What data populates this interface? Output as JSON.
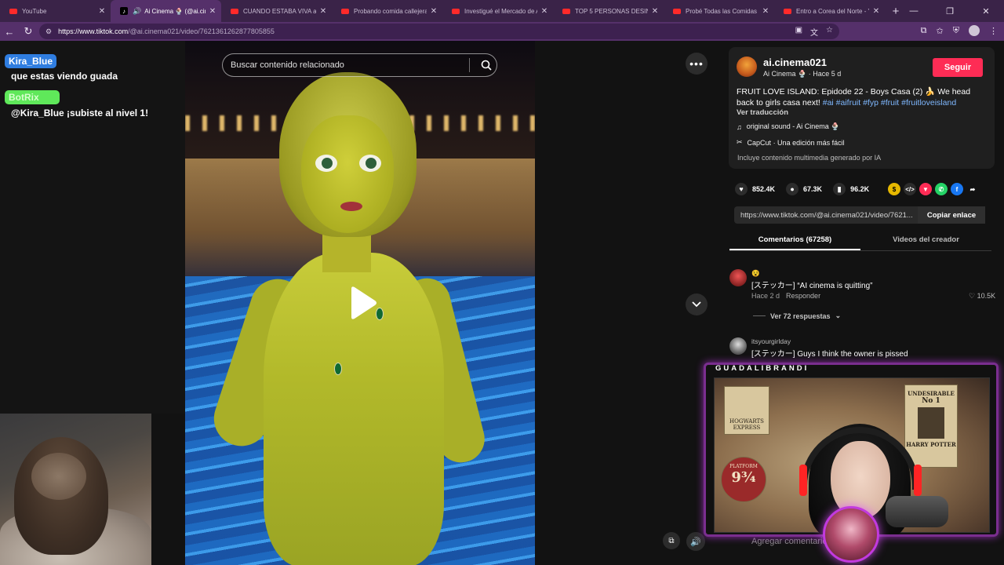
{
  "browser": {
    "tabs": [
      {
        "title": "YouTube",
        "type": "yt",
        "active": false
      },
      {
        "title": "Ai Cinema 🍨 (@ai.cinema",
        "type": "tt",
        "active": true
      },
      {
        "title": "CUANDO ESTABA VIVA a NA",
        "type": "yt",
        "active": false
      },
      {
        "title": "Probando comida callejera e",
        "type": "yt",
        "active": false
      },
      {
        "title": "Investigué el Mercado de An",
        "type": "yt",
        "active": false
      },
      {
        "title": "TOP 5 PERSONAS DESINFOR",
        "type": "yt",
        "active": false
      },
      {
        "title": "Probé Todas las Comidas XX",
        "type": "yt",
        "active": false
      },
      {
        "title": "Entro a Corea del Norte - Yo",
        "type": "yt",
        "active": false
      }
    ],
    "url_host": "https://www.tiktok.com",
    "url_path": "/@ai.cinema021/video/7621361262877805855"
  },
  "chat": {
    "user1": "Kira_Blue",
    "msg1": "que estas viendo guada",
    "user2": "BotRix",
    "msg2": "@Kira_Blue ¡subiste al nivel 1!"
  },
  "search": {
    "placeholder": "Buscar contenido relacionado"
  },
  "creator": {
    "handle": "ai.cinema021",
    "name": "Ai Cinema 🍨",
    "age": "Hace 5 d",
    "follow_label": "Seguir"
  },
  "caption": {
    "text": "FRUIT LOVE ISLAND: Epidode 22 - Boys Casa (2) 🍌 We head back to girls casa next!",
    "tags": "#ai #aifruit #fyp #fruit #fruitloveisland",
    "see_translation": "Ver traducción",
    "sound": "original sound - Ai Cinema 🍨",
    "capcut": "CapCut · Una edición más fácil",
    "ai_note": "Incluye contenido multimedia generado por IA"
  },
  "stats": {
    "likes": "852.4K",
    "comments": "67.3K",
    "saves": "96.2K"
  },
  "link": {
    "url": "https://www.tiktok.com/@ai.cinema021/video/7621...",
    "copy_label": "Copiar enlace"
  },
  "tabs": {
    "comments": "Comentarios (67258)",
    "creator_videos": "Videos del creador"
  },
  "comments": [
    {
      "user": "😵",
      "text": "[ステッカー] “AI cinema is quitting”",
      "age": "Hace 2 d",
      "reply": "Responder",
      "likes": "10.5K",
      "replies": "Ver 72 respuestas"
    },
    {
      "user": "itsyourgirlday",
      "text": "[ステッカー] Guys I think the owner is pissed"
    }
  ],
  "comment_input": {
    "placeholder": "Agregar comentario..."
  },
  "stream_overlay": {
    "label": "GUADALIBRANDI"
  },
  "posters": {
    "hogwarts": "HOGWARTS EXPRESS",
    "platform": "PLATFORM",
    "platform_num": "9¾",
    "undesirable": "UNDESIRABLE",
    "no1": "No 1",
    "harry": "HARRY POTTER"
  },
  "colors": {
    "accent": "#fe2c55",
    "tab_bar": "#3a2348",
    "address_bar": "#55306a",
    "overlay_border": "#7a2e8f"
  }
}
